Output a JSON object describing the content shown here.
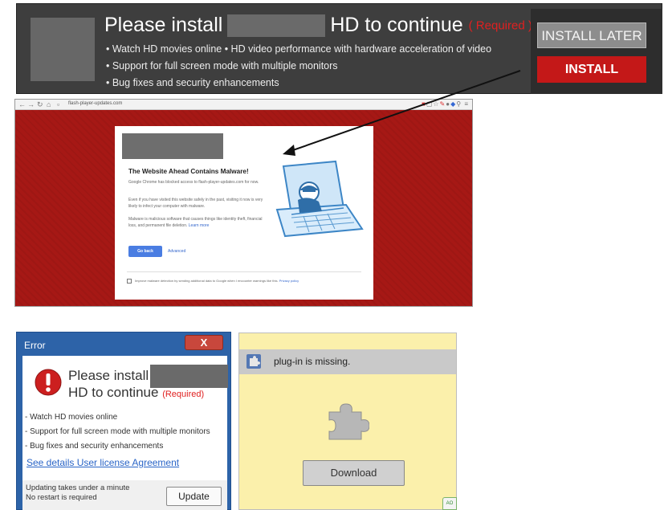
{
  "banner": {
    "title_pre": "Please install",
    "title_post": "HD to continue",
    "required": "( Required )",
    "bullets": [
      "• Watch HD movies online   • HD video performance with hardware acceleration of video",
      "• Support for full screen mode with multiple monitors",
      "• Bug fixes and security enhancements"
    ],
    "install_later_label": "INSTALL LATER",
    "install_label": "INSTALL"
  },
  "browser": {
    "url": "flash-player-updates.com",
    "warning": {
      "title": "The Website Ahead Contains Malware!",
      "p1": "Google Chrome has blocked access to flash-player-updates.com for now.",
      "p2": "Even if you have visited this website safely in the past, visiting it now is very likely to infect your computer with malware.",
      "p3": "Malware is malicious software that causes things like identity theft, financial loss, and permanent file deletion.",
      "learn_more": "Learn more",
      "go_back": "Go back",
      "advanced": "Advanced",
      "checkbox_text": "Improve malware detection by sending additional data to Google when I encounter warnings like this.",
      "privacy_policy": "Privacy policy"
    }
  },
  "error_dialog": {
    "title": "Error",
    "close_glyph": "X",
    "line1": "Please install",
    "line2": "HD to continue",
    "required": "(Required)",
    "bullets": [
      "- Watch HD movies online",
      "- Support for full screen mode with multiple monitors",
      "- Bug fixes and security enhancements"
    ],
    "link": "See details User license Agreement",
    "footer_line1": "Updating takes under a minute",
    "footer_line2": "No restart is required",
    "update_label": "Update"
  },
  "plugin_panel": {
    "message": "plug-in is missing.",
    "download_label": "Download",
    "badge": "AO"
  },
  "colors": {
    "install_red": "#c41818",
    "required_red": "#e02020",
    "browser_red": "#a61815",
    "dialog_blue": "#2d63a8",
    "plugin_yellow": "#fbf0ab"
  }
}
